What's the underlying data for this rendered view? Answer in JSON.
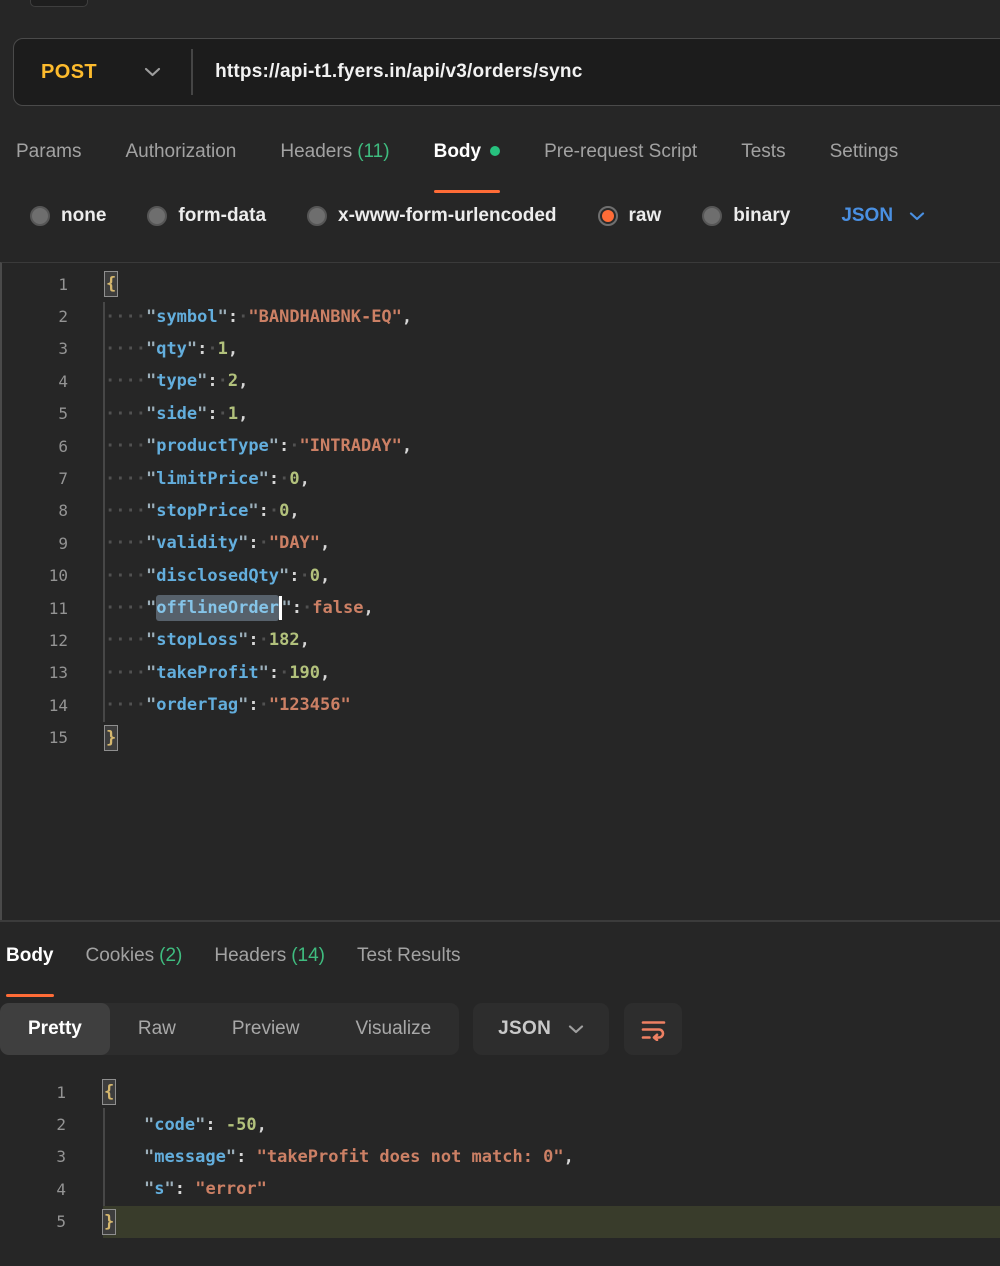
{
  "colors": {
    "accent_orange": "#ff6c37",
    "method_post_yellow": "#fdbb2d",
    "count_green": "#3fbc7f",
    "format_blue": "#4a90e2",
    "editor_key_blue": "#63aedd",
    "editor_string_salmon": "#cc8065",
    "editor_number_green": "#b2c17c",
    "editor_brace_gold": "#d5b76e",
    "active_line_olive": "#393c2b"
  },
  "request_bar": {
    "method": "POST",
    "url": "https://api-t1.fyers.in/api/v3/orders/sync"
  },
  "request_tabs": {
    "items": [
      {
        "label": "Params"
      },
      {
        "label": "Authorization"
      },
      {
        "label": "Headers",
        "count": "(11)"
      },
      {
        "label": "Body",
        "active": true,
        "dot": true
      },
      {
        "label": "Pre-request Script"
      },
      {
        "label": "Tests"
      },
      {
        "label": "Settings"
      }
    ]
  },
  "body_type_options": {
    "items": [
      {
        "label": "none"
      },
      {
        "label": "form-data"
      },
      {
        "label": "x-www-form-urlencoded"
      },
      {
        "label": "raw",
        "selected": true
      },
      {
        "label": "binary"
      }
    ],
    "format_label": "JSON"
  },
  "request_editor": {
    "lines": [
      {
        "n": 1,
        "t": [
          [
            "bracebox",
            "{"
          ]
        ]
      },
      {
        "n": 2,
        "t": [
          [
            "ws",
            "····"
          ],
          [
            "q",
            "\""
          ],
          [
            "key",
            "symbol"
          ],
          [
            "q",
            "\""
          ],
          [
            "p",
            ":"
          ],
          [
            "ws",
            "·"
          ],
          [
            "str",
            "\"BANDHANBNK-EQ\""
          ],
          [
            "p",
            ","
          ]
        ]
      },
      {
        "n": 3,
        "t": [
          [
            "ws",
            "····"
          ],
          [
            "q",
            "\""
          ],
          [
            "key",
            "qty"
          ],
          [
            "q",
            "\""
          ],
          [
            "p",
            ":"
          ],
          [
            "ws",
            "·"
          ],
          [
            "num",
            "1"
          ],
          [
            "p",
            ","
          ]
        ]
      },
      {
        "n": 4,
        "t": [
          [
            "ws",
            "····"
          ],
          [
            "q",
            "\""
          ],
          [
            "key",
            "type"
          ],
          [
            "q",
            "\""
          ],
          [
            "p",
            ":"
          ],
          [
            "ws",
            "·"
          ],
          [
            "num",
            "2"
          ],
          [
            "p",
            ","
          ]
        ]
      },
      {
        "n": 5,
        "t": [
          [
            "ws",
            "····"
          ],
          [
            "q",
            "\""
          ],
          [
            "key",
            "side"
          ],
          [
            "q",
            "\""
          ],
          [
            "p",
            ":"
          ],
          [
            "ws",
            "·"
          ],
          [
            "num",
            "1"
          ],
          [
            "p",
            ","
          ]
        ]
      },
      {
        "n": 6,
        "t": [
          [
            "ws",
            "····"
          ],
          [
            "q",
            "\""
          ],
          [
            "key",
            "productType"
          ],
          [
            "q",
            "\""
          ],
          [
            "p",
            ":"
          ],
          [
            "ws",
            "·"
          ],
          [
            "str",
            "\"INTRADAY\""
          ],
          [
            "p",
            ","
          ]
        ]
      },
      {
        "n": 7,
        "t": [
          [
            "ws",
            "····"
          ],
          [
            "q",
            "\""
          ],
          [
            "key",
            "limitPrice"
          ],
          [
            "q",
            "\""
          ],
          [
            "p",
            ":"
          ],
          [
            "ws",
            "·"
          ],
          [
            "num",
            "0"
          ],
          [
            "p",
            ","
          ]
        ]
      },
      {
        "n": 8,
        "t": [
          [
            "ws",
            "····"
          ],
          [
            "q",
            "\""
          ],
          [
            "key",
            "stopPrice"
          ],
          [
            "q",
            "\""
          ],
          [
            "p",
            ":"
          ],
          [
            "ws",
            "·"
          ],
          [
            "num",
            "0"
          ],
          [
            "p",
            ","
          ]
        ]
      },
      {
        "n": 9,
        "t": [
          [
            "ws",
            "····"
          ],
          [
            "q",
            "\""
          ],
          [
            "key",
            "validity"
          ],
          [
            "q",
            "\""
          ],
          [
            "p",
            ":"
          ],
          [
            "ws",
            "·"
          ],
          [
            "str",
            "\"DAY\""
          ],
          [
            "p",
            ","
          ]
        ]
      },
      {
        "n": 10,
        "t": [
          [
            "ws",
            "····"
          ],
          [
            "q",
            "\""
          ],
          [
            "key",
            "disclosedQty"
          ],
          [
            "q",
            "\""
          ],
          [
            "p",
            ":"
          ],
          [
            "ws",
            "·"
          ],
          [
            "num",
            "0"
          ],
          [
            "p",
            ","
          ]
        ]
      },
      {
        "n": 11,
        "t": [
          [
            "ws",
            "····"
          ],
          [
            "q",
            "\""
          ],
          [
            "sel",
            "offlineOrder"
          ],
          [
            "caret",
            ""
          ],
          [
            "q",
            "\""
          ],
          [
            "p",
            ":"
          ],
          [
            "ws",
            "·"
          ],
          [
            "bool",
            "false"
          ],
          [
            "p",
            ","
          ]
        ]
      },
      {
        "n": 12,
        "t": [
          [
            "ws",
            "····"
          ],
          [
            "q",
            "\""
          ],
          [
            "key",
            "stopLoss"
          ],
          [
            "q",
            "\""
          ],
          [
            "p",
            ":"
          ],
          [
            "ws",
            "·"
          ],
          [
            "num",
            "182"
          ],
          [
            "p",
            ","
          ]
        ]
      },
      {
        "n": 13,
        "t": [
          [
            "ws",
            "····"
          ],
          [
            "q",
            "\""
          ],
          [
            "key",
            "takeProfit"
          ],
          [
            "q",
            "\""
          ],
          [
            "p",
            ":"
          ],
          [
            "ws",
            "·"
          ],
          [
            "num",
            "190"
          ],
          [
            "p",
            ","
          ]
        ]
      },
      {
        "n": 14,
        "t": [
          [
            "ws",
            "····"
          ],
          [
            "q",
            "\""
          ],
          [
            "key",
            "orderTag"
          ],
          [
            "q",
            "\""
          ],
          [
            "p",
            ":"
          ],
          [
            "ws",
            "·"
          ],
          [
            "str",
            "\"123456\""
          ]
        ]
      },
      {
        "n": 15,
        "t": [
          [
            "bracebox",
            "}"
          ]
        ]
      }
    ]
  },
  "response_tabs": {
    "items": [
      {
        "label": "Body",
        "active": true
      },
      {
        "label": "Cookies",
        "count": "(2)"
      },
      {
        "label": "Headers",
        "count": "(14)"
      },
      {
        "label": "Test Results"
      }
    ]
  },
  "response_toolbar": {
    "views": [
      {
        "label": "Pretty",
        "active": true
      },
      {
        "label": "Raw"
      },
      {
        "label": "Preview"
      },
      {
        "label": "Visualize"
      }
    ],
    "format_label": "JSON",
    "wrap_icon": "word-wrap-icon"
  },
  "response_editor": {
    "lines": [
      {
        "n": 1,
        "t": [
          [
            "bracebox",
            "{"
          ]
        ]
      },
      {
        "n": 2,
        "t": [
          [
            "sp",
            "    "
          ],
          [
            "q",
            "\""
          ],
          [
            "key",
            "code"
          ],
          [
            "q",
            "\""
          ],
          [
            "p",
            ":"
          ],
          [
            "sp",
            " "
          ],
          [
            "num",
            "-50"
          ],
          [
            "p",
            ","
          ]
        ]
      },
      {
        "n": 3,
        "t": [
          [
            "sp",
            "    "
          ],
          [
            "q",
            "\""
          ],
          [
            "key",
            "message"
          ],
          [
            "q",
            "\""
          ],
          [
            "p",
            ":"
          ],
          [
            "sp",
            " "
          ],
          [
            "str",
            "\"takeProfit does not match: 0\""
          ],
          [
            "p",
            ","
          ]
        ]
      },
      {
        "n": 4,
        "t": [
          [
            "sp",
            "    "
          ],
          [
            "q",
            "\""
          ],
          [
            "key",
            "s"
          ],
          [
            "q",
            "\""
          ],
          [
            "p",
            ":"
          ],
          [
            "sp",
            " "
          ],
          [
            "str",
            "\"error\""
          ]
        ]
      },
      {
        "n": 5,
        "t": [
          [
            "bracebox",
            "}"
          ]
        ],
        "hl": true
      }
    ]
  }
}
